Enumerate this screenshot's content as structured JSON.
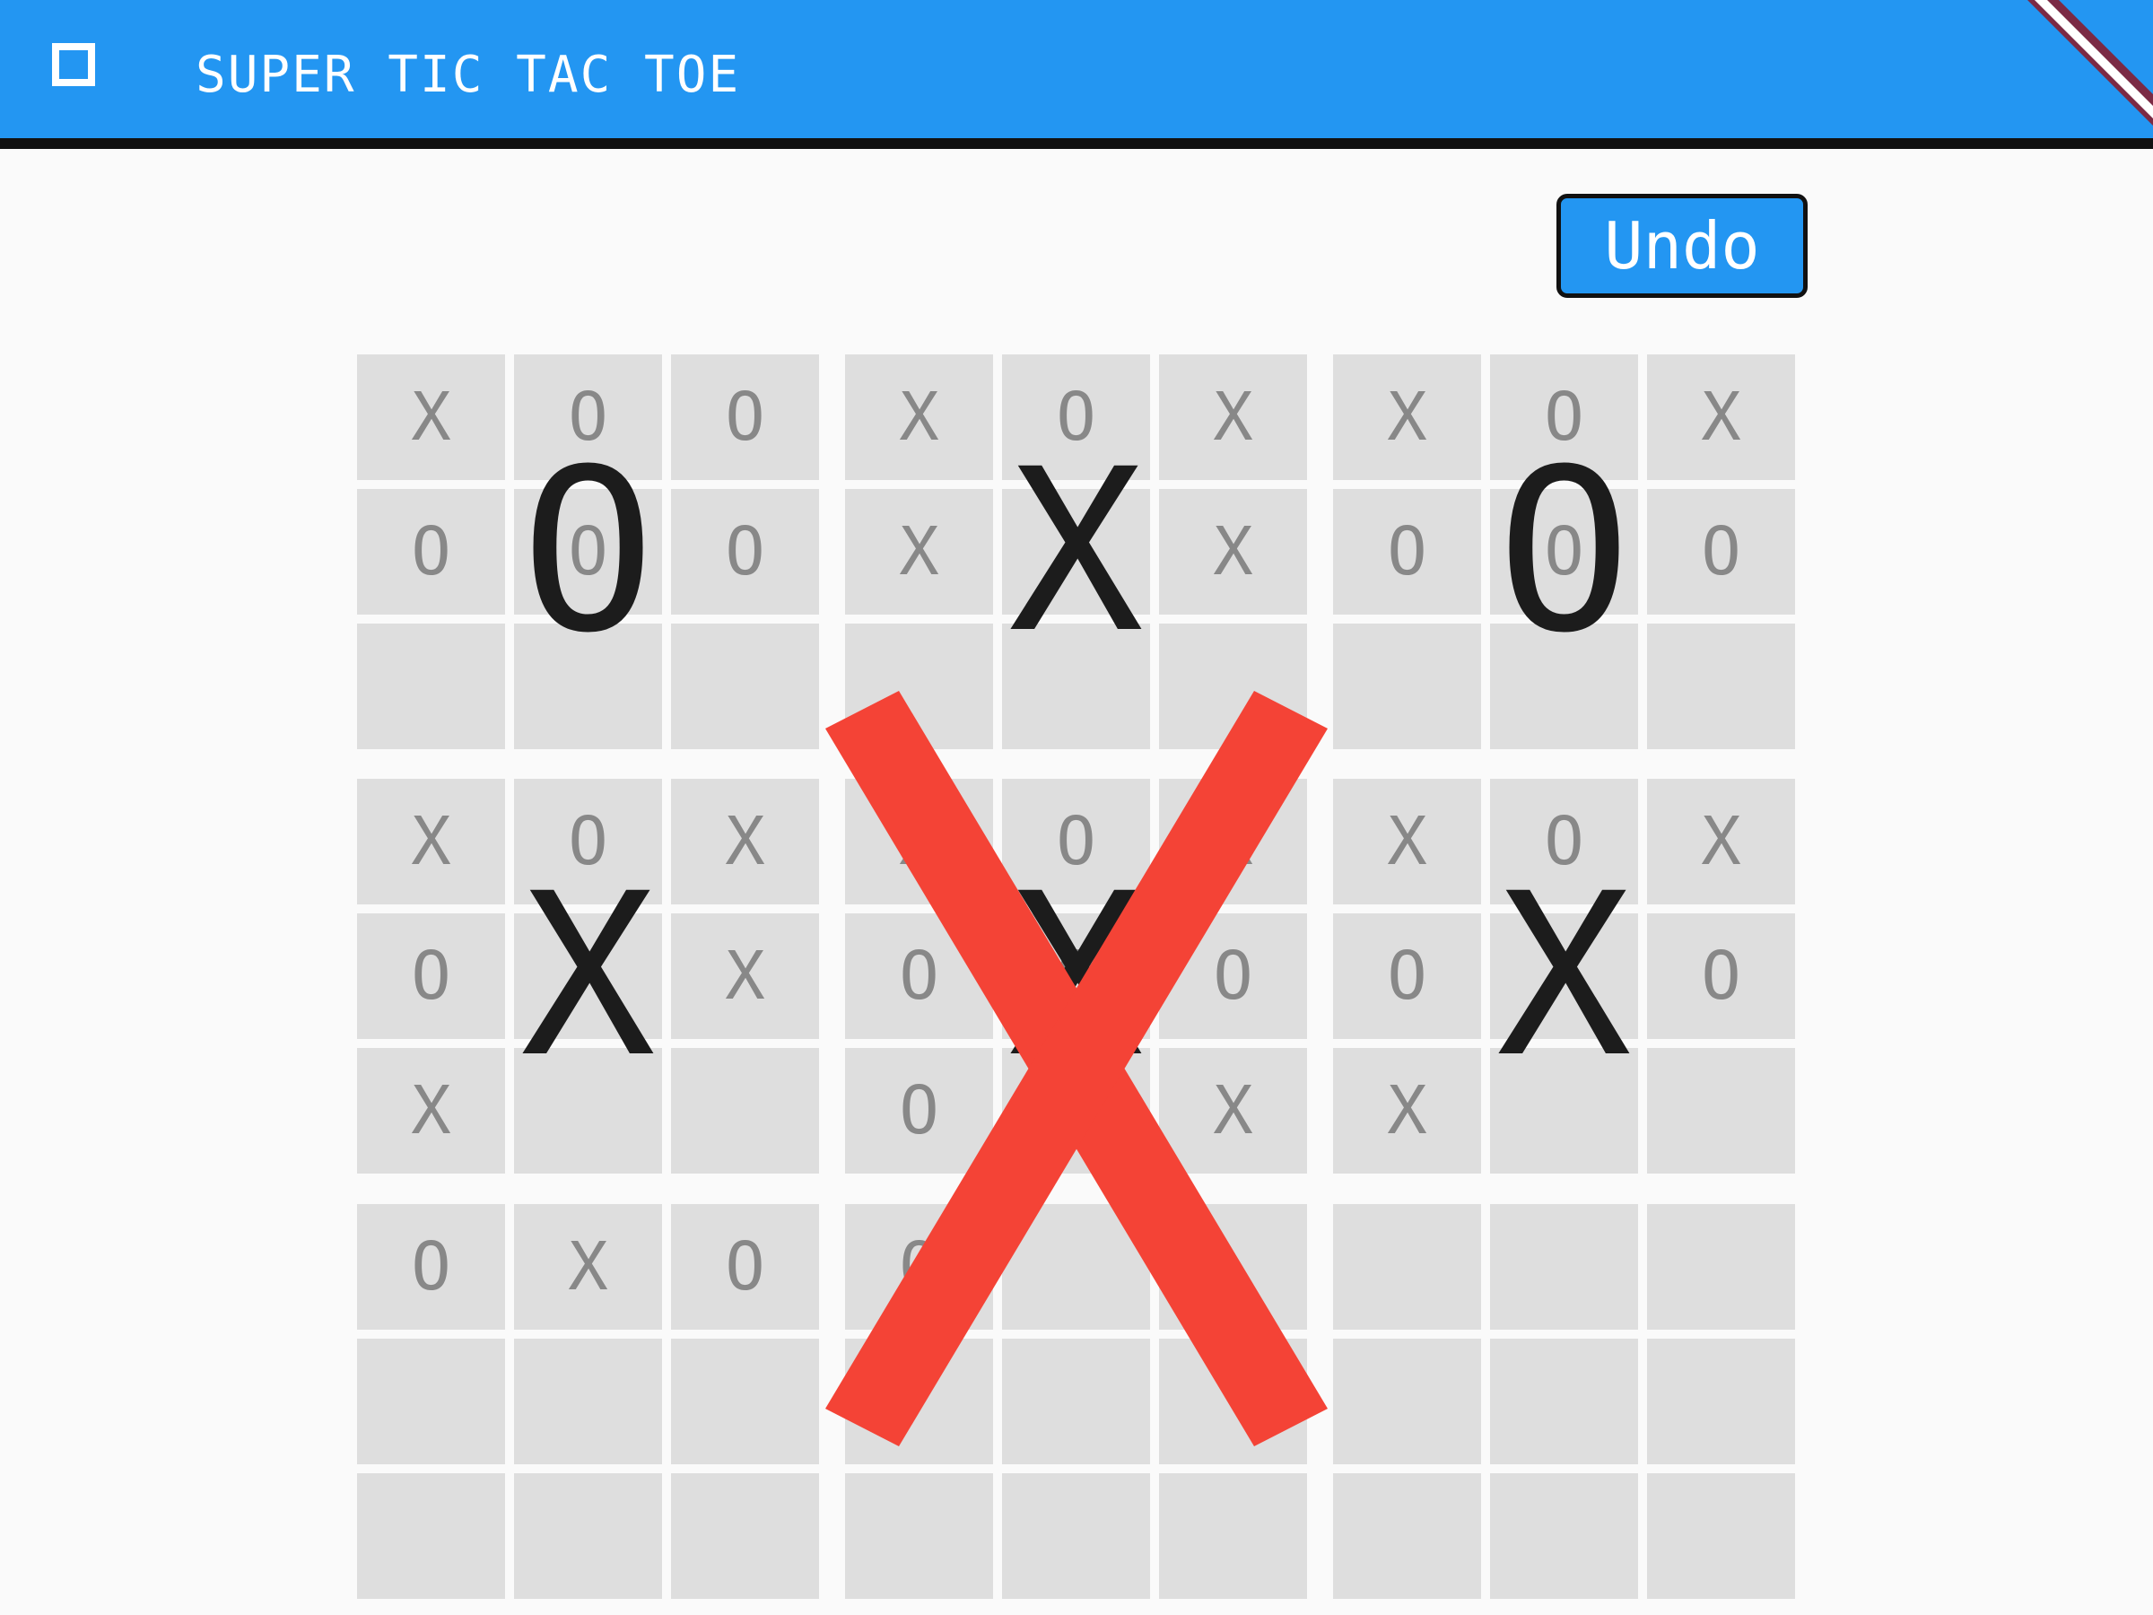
{
  "app_bar": {
    "title": "SUPER TIC TAC TOE",
    "background_color": "#2396f2",
    "menu_icon": "square-outline-icon"
  },
  "controls": {
    "undo_label": "Undo"
  },
  "game": {
    "overall_winner": "X",
    "overall_winner_color": "#f44336",
    "subboards": [
      {
        "winner": "O",
        "cells": [
          "X",
          "O",
          "O",
          "O",
          "O",
          "O",
          "",
          "",
          ""
        ]
      },
      {
        "winner": "X",
        "cells": [
          "X",
          "O",
          "X",
          "X",
          "X",
          "X",
          "",
          "",
          ""
        ]
      },
      {
        "winner": "O",
        "cells": [
          "X",
          "O",
          "X",
          "O",
          "O",
          "O",
          "",
          "",
          ""
        ]
      },
      {
        "winner": "X",
        "cells": [
          "X",
          "O",
          "X",
          "O",
          "X",
          "X",
          "X",
          "",
          ""
        ]
      },
      {
        "winner": "X",
        "cells": [
          "X",
          "O",
          "X",
          "O",
          "O",
          "O",
          "O",
          "",
          "X"
        ]
      },
      {
        "winner": "X",
        "cells": [
          "X",
          "O",
          "X",
          "O",
          "X",
          "O",
          "X",
          "",
          ""
        ]
      },
      {
        "winner": "",
        "cells": [
          "O",
          "X",
          "O",
          "",
          "",
          "",
          "",
          "",
          ""
        ]
      },
      {
        "winner": "",
        "cells": [
          "O",
          "",
          "",
          "",
          "",
          "",
          "",
          "",
          ""
        ]
      },
      {
        "winner": "",
        "cells": [
          "",
          "",
          "",
          "",
          "",
          "",
          "",
          "",
          ""
        ]
      }
    ]
  }
}
